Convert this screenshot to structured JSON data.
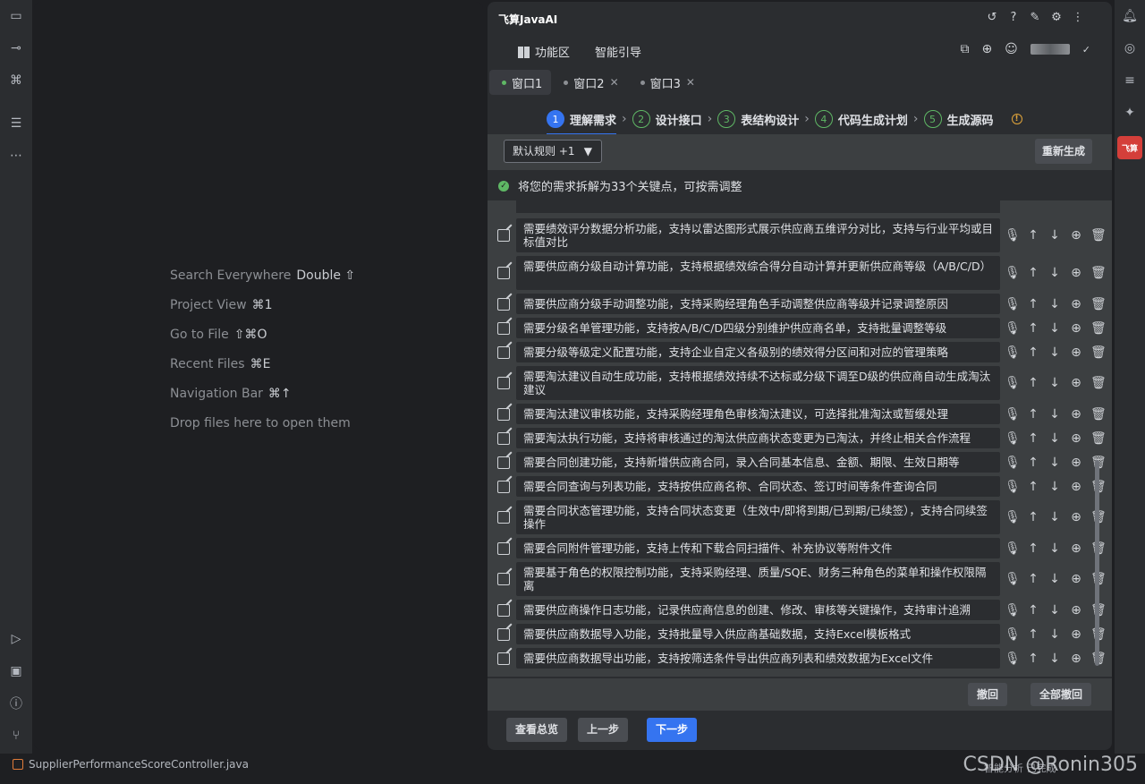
{
  "editor_hints": [
    {
      "label": "Search Everywhere",
      "shortcut": "Double ⇧"
    },
    {
      "label": "Project View",
      "shortcut": "⌘1"
    },
    {
      "label": "Go to File",
      "shortcut": "⇧⌘O"
    },
    {
      "label": "Recent Files",
      "shortcut": "⌘E"
    },
    {
      "label": "Navigation Bar",
      "shortcut": "⌘↑"
    },
    {
      "label": "Drop files here to open them",
      "shortcut": ""
    }
  ],
  "status": {
    "file_name": "SupplierPerformanceScoreController.java",
    "watermark": "CSDN @Ronin305",
    "right_text": "智能分析  已完成"
  },
  "panel": {
    "title": "飞算JavaAI",
    "function_tab": "功能区",
    "smart_tab": "智能引导",
    "windows": [
      "窗口1",
      "窗口2",
      "窗口3"
    ],
    "steps": [
      {
        "num": "1",
        "label": "理解需求"
      },
      {
        "num": "2",
        "label": "设计接口"
      },
      {
        "num": "3",
        "label": "表结构设计"
      },
      {
        "num": "4",
        "label": "代码生成计划"
      },
      {
        "num": "5",
        "label": "生成源码"
      }
    ],
    "rule_select": "默认规则 +1",
    "regenerate": "重新生成",
    "summary": "将您的需求拆解为33个关键点，可按需调整",
    "requirements": [
      "需要绩效评分数据分析功能，支持以雷达图形式展示供应商五维评分对比，支持与行业平均或目标值对比",
      "需要供应商分级自动计算功能，支持根据绩效综合得分自动计算并更新供应商等级（A/B/C/D）",
      "需要供应商分级手动调整功能，支持采购经理角色手动调整供应商等级并记录调整原因",
      "需要分级名单管理功能，支持按A/B/C/D四级分别维护供应商名单，支持批量调整等级",
      "需要分级等级定义配置功能，支持企业自定义各级别的绩效得分区间和对应的管理策略",
      "需要淘汰建议自动生成功能，支持根据绩效持续不达标或分级下调至D级的供应商自动生成淘汰建议",
      "需要淘汰建议审核功能，支持采购经理角色审核淘汰建议，可选择批准淘汰或暂缓处理",
      "需要淘汰执行功能，支持将审核通过的淘汰供应商状态变更为已淘汰，并终止相关合作流程",
      "需要合同创建功能，支持新增供应商合同，录入合同基本信息、金额、期限、生效日期等",
      "需要合同查询与列表功能，支持按供应商名称、合同状态、签订时间等条件查询合同",
      "需要合同状态管理功能，支持合同状态变更（生效中/即将到期/已到期/已续签），支持合同续签操作",
      "需要合同附件管理功能，支持上传和下载合同扫描件、补充协议等附件文件",
      "需要基于角色的权限控制功能，支持采购经理、质量/SQE、财务三种角色的菜单和操作权限隔离",
      "需要供应商操作日志功能，记录供应商信息的创建、修改、审核等关键操作，支持审计追溯",
      "需要供应商数据导入功能，支持批量导入供应商基础数据，支持Excel模板格式",
      "需要供应商数据导出功能，支持按筛选条件导出供应商列表和绩效数据为Excel文件"
    ],
    "undo": "撤回",
    "undo_all": "全部撤回",
    "view_overview": "查看总览",
    "prev": "上一步",
    "next": "下一步"
  },
  "colors": {
    "accent": "#3574f0",
    "success": "#5fb865",
    "warning": "#e0a43a",
    "brand": "#d43f3a"
  }
}
